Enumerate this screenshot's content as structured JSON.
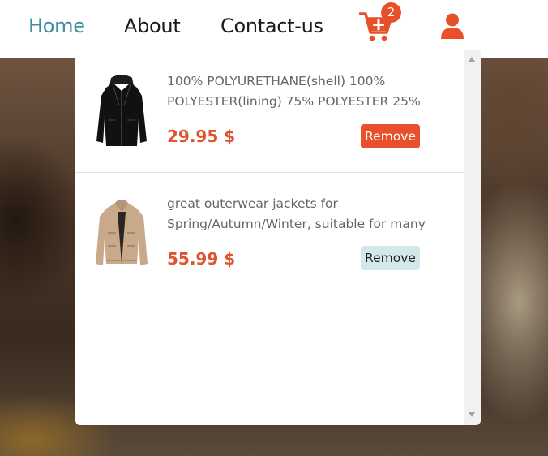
{
  "nav": {
    "links": [
      {
        "label": "Home",
        "active": true
      },
      {
        "label": "About",
        "active": false
      },
      {
        "label": "Contact-us",
        "active": false
      }
    ],
    "cart_count": "2",
    "cart_icon": "cart-plus-icon",
    "user_icon": "user-icon"
  },
  "cart": {
    "items": [
      {
        "image": "black-leather-jacket",
        "desc_line1": "100% POLYURETHANE(shell) 100%",
        "desc_line2": "POLYESTER(lining) 75% POLYESTER 25%",
        "price": "29.95 $",
        "remove_label": "Remove"
      },
      {
        "image": "beige-cotton-jacket",
        "desc_line1": "great outerwear jackets for",
        "desc_line2": "Spring/Autumn/Winter, suitable for many",
        "price": "55.99 $",
        "remove_label": "Remove"
      }
    ]
  },
  "colors": {
    "accent": "#e8502a",
    "nav_active": "#3d8fa0",
    "price": "#e0532e",
    "remove_secondary_bg": "#d4e8ec"
  }
}
